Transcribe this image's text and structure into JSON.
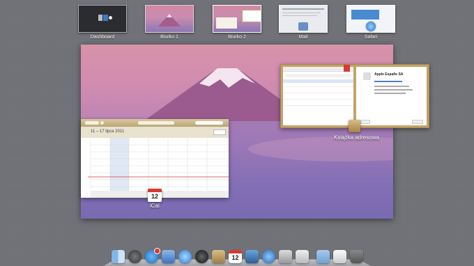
{
  "spaces": [
    {
      "label": "Dashboard"
    },
    {
      "label": "Biurko 1"
    },
    {
      "label": "Biurko 2"
    },
    {
      "label": "Mail"
    },
    {
      "label": "Safari"
    }
  ],
  "ical": {
    "app_label": "iCal",
    "week_title": "11 – 17 lipca 2011",
    "icon_date": "12"
  },
  "address_book": {
    "app_label": "Książka adresowa",
    "contact_name": "Apple Españe SA"
  },
  "dock": {
    "items": [
      "finder-icon",
      "launchpad-icon",
      "app-store-icon",
      "mail-icon",
      "safari-icon",
      "facetime-icon",
      "address-book-icon",
      "ical-icon",
      "iphoto-icon",
      "itunes-icon",
      "preview-icon",
      "system-preferences-icon",
      "folder-icon",
      "documents-icon",
      "trash-icon"
    ],
    "ical_date": "12"
  },
  "colors": {
    "background": "#6e7076",
    "wallpaper_top": "#d892a9",
    "wallpaper_bottom": "#6a63ae",
    "badge": "#e0352b"
  }
}
